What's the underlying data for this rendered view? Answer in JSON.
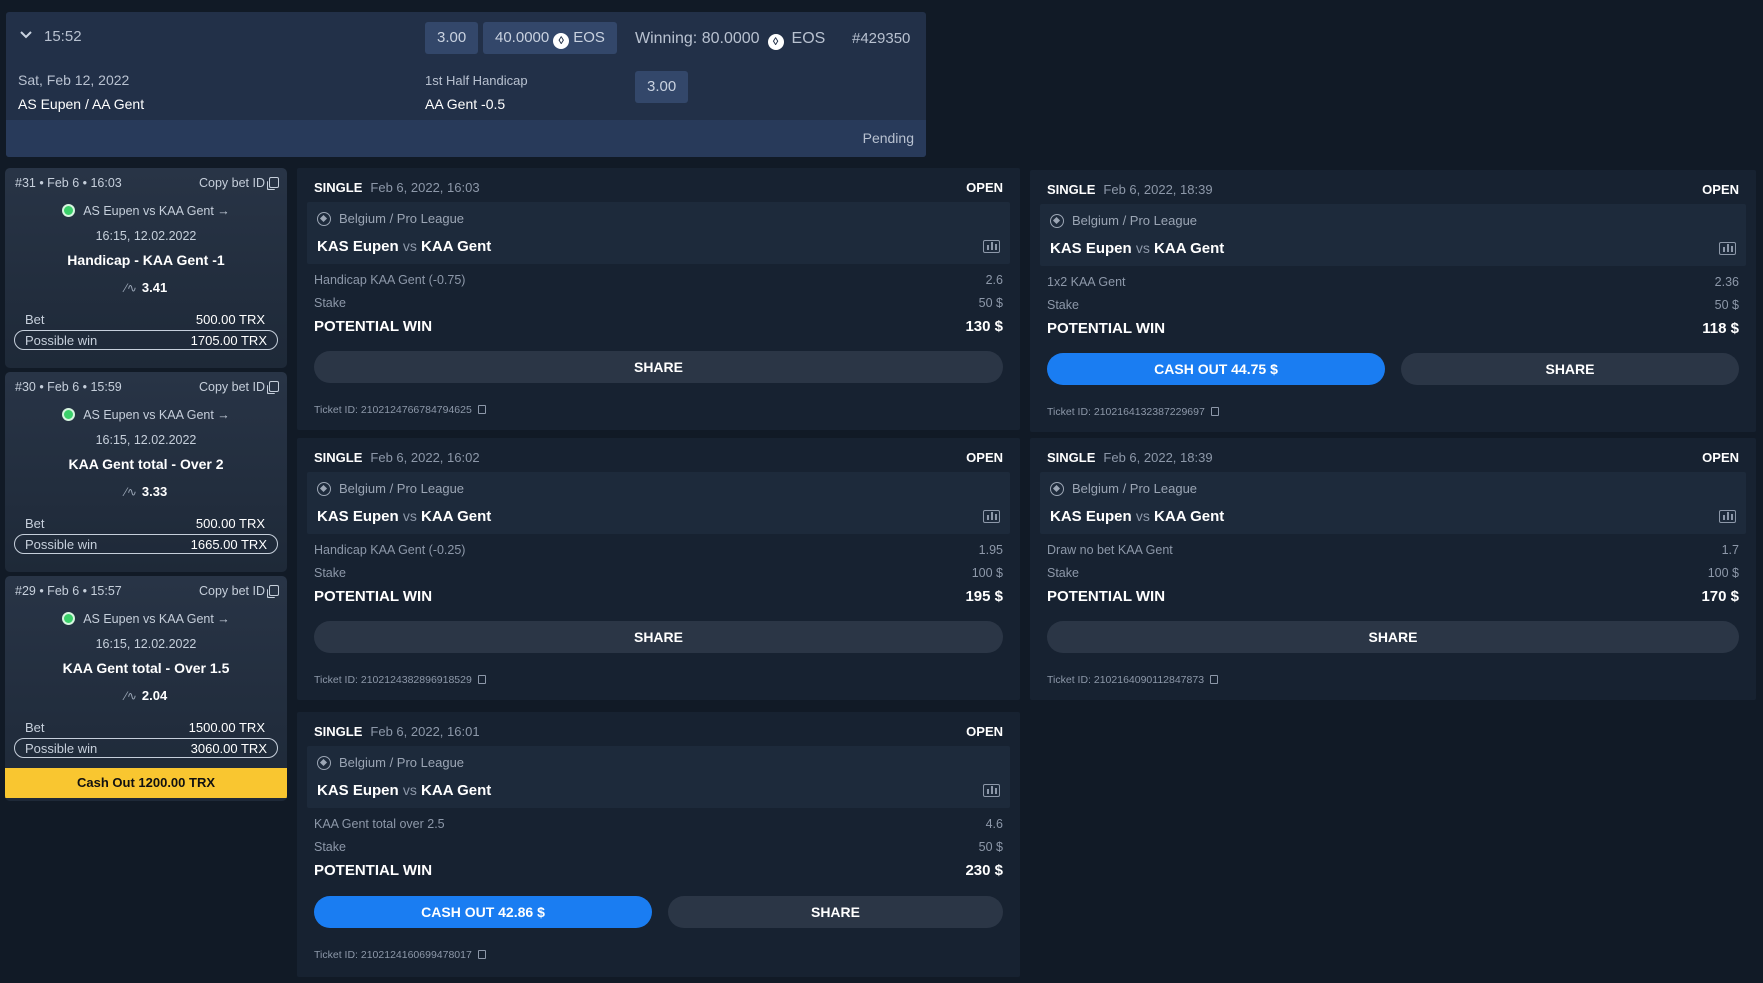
{
  "top_ticket": {
    "time": "15:52",
    "date": "Sat, Feb 12, 2022",
    "match": "AS Eupen / AA Gent",
    "odds_chip": "3.00",
    "stake_chip": "40.0000",
    "currency": "EOS",
    "winning_label": "Winning: 80.0000",
    "winning_currency": "EOS",
    "ticket_no": "#429350",
    "market": "1st Half Handicap",
    "selection": "AA Gent -0.5",
    "selection_odds": "3.00",
    "status": "Pending"
  },
  "left_cards": [
    {
      "header": "#31 • Feb 6 • 16:03",
      "copy": "Copy bet ID",
      "match": "AS Eupen vs KAA Gent →",
      "datetime": "16:15, 12.02.2022",
      "market": "Handicap - KAA Gent -1",
      "odds": "3.41",
      "bet_label": "Bet",
      "bet_value": "500.00 TRX",
      "win_label": "Possible win",
      "win_value": "1705.00 TRX"
    },
    {
      "header": "#30 • Feb 6 • 15:59",
      "copy": "Copy bet ID",
      "match": "AS Eupen vs KAA Gent →",
      "datetime": "16:15, 12.02.2022",
      "market": "KAA Gent total - Over 2",
      "odds": "3.33",
      "bet_label": "Bet",
      "bet_value": "500.00 TRX",
      "win_label": "Possible win",
      "win_value": "1665.00 TRX"
    },
    {
      "header": "#29 • Feb 6 • 15:57",
      "copy": "Copy bet ID",
      "match": "AS Eupen vs KAA Gent →",
      "datetime": "16:15, 12.02.2022",
      "market": "KAA Gent total - Over 1.5",
      "odds": "2.04",
      "bet_label": "Bet",
      "bet_value": "1500.00 TRX",
      "win_label": "Possible win",
      "win_value": "3060.00 TRX",
      "cashout": "Cash Out 1200.00 TRX"
    }
  ],
  "tickets": [
    {
      "type": "SINGLE",
      "date": "Feb 6, 2022, 16:03",
      "status": "OPEN",
      "league": "Belgium / Pro League",
      "home": "KAS Eupen",
      "vs": "vs",
      "away": "KAA Gent",
      "pick": "Handicap KAA Gent (-0.75)",
      "pick_odds": "2.6",
      "stake_label": "Stake",
      "stake": "50 $",
      "pw_label": "POTENTIAL WIN",
      "pw": "130 $",
      "share": "SHARE",
      "ticket_id": "Ticket ID: 2102124766784794625"
    },
    {
      "type": "SINGLE",
      "date": "Feb 6, 2022, 18:39",
      "status": "OPEN",
      "league": "Belgium / Pro League",
      "home": "KAS Eupen",
      "vs": "vs",
      "away": "KAA Gent",
      "pick": "1x2 KAA Gent",
      "pick_odds": "2.36",
      "stake_label": "Stake",
      "stake": "50 $",
      "pw_label": "POTENTIAL WIN",
      "pw": "118 $",
      "cashout": "CASH OUT 44.75 $",
      "share": "SHARE",
      "ticket_id": "Ticket ID: 2102164132387229697"
    },
    {
      "type": "SINGLE",
      "date": "Feb 6, 2022, 16:02",
      "status": "OPEN",
      "league": "Belgium / Pro League",
      "home": "KAS Eupen",
      "vs": "vs",
      "away": "KAA Gent",
      "pick": "Handicap KAA Gent (-0.25)",
      "pick_odds": "1.95",
      "stake_label": "Stake",
      "stake": "100 $",
      "pw_label": "POTENTIAL WIN",
      "pw": "195 $",
      "share": "SHARE",
      "ticket_id": "Ticket ID: 2102124382896918529"
    },
    {
      "type": "SINGLE",
      "date": "Feb 6, 2022, 18:39",
      "status": "OPEN",
      "league": "Belgium / Pro League",
      "home": "KAS Eupen",
      "vs": "vs",
      "away": "KAA Gent",
      "pick": "Draw no bet KAA Gent",
      "pick_odds": "1.7",
      "stake_label": "Stake",
      "stake": "100 $",
      "pw_label": "POTENTIAL WIN",
      "pw": "170 $",
      "share": "SHARE",
      "ticket_id": "Ticket ID: 2102164090112847873"
    },
    {
      "type": "SINGLE",
      "date": "Feb 6, 2022, 16:01",
      "status": "OPEN",
      "league": "Belgium / Pro League",
      "home": "KAS Eupen",
      "vs": "vs",
      "away": "KAA Gent",
      "pick": "KAA Gent total over 2.5",
      "pick_odds": "4.6",
      "stake_label": "Stake",
      "stake": "50 $",
      "pw_label": "POTENTIAL WIN",
      "pw": "230 $",
      "cashout": "CASH OUT 42.86 $",
      "share": "SHARE",
      "ticket_id": "Ticket ID: 2102124160699478017"
    }
  ],
  "colors": {
    "background": "#111a26",
    "cashout_blue": "#1a7df2",
    "cashout_yellow": "#f9c630",
    "status_green": "#3bd06a"
  }
}
